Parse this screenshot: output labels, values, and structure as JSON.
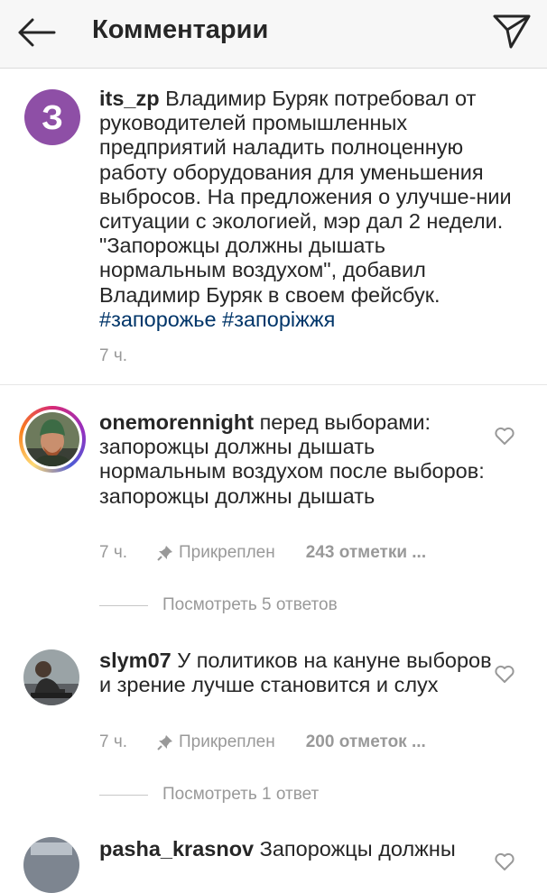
{
  "header": {
    "title": "Комментарии"
  },
  "caption": {
    "username": "its_zp",
    "text": "Владимир Буряк потребовал от руководителей промышленных предприятий наладить полноценную работу оборудования для уменьшения выбросов. На предложения о улучше-нии ситуации с экологией, мэр дал 2 недели. \"Запорожцы должны дышать нормальным воздухом\", добавил Владимир Буряк в своем фейсбук.",
    "hashtags": "#запорожье #запоріжжя",
    "time": "7 ч.",
    "avatar_letter": "З"
  },
  "comments": [
    {
      "username": "onemorennight",
      "text": "перед выборами: запорожцы должны дышать нормальным воздухом после выборов: запорожцы должны дышать",
      "time": "7 ч.",
      "pinned_label": "Прикреплен",
      "likes": "243 отметки ...",
      "replies": "Посмотреть 5 ответов"
    },
    {
      "username": "slym07",
      "text": "У политиков на кануне выборов и зрение лучше становится и слух",
      "time": "7 ч.",
      "pinned_label": "Прикреплен",
      "likes": "200 отметок ...",
      "replies": "Посмотреть 1 ответ"
    },
    {
      "username": "pasha_krasnov",
      "text": "Запорожцы должны"
    }
  ],
  "colors": {
    "avatar_purple": "#8e4fa6",
    "hashtag": "#003569",
    "muted": "#999999"
  }
}
